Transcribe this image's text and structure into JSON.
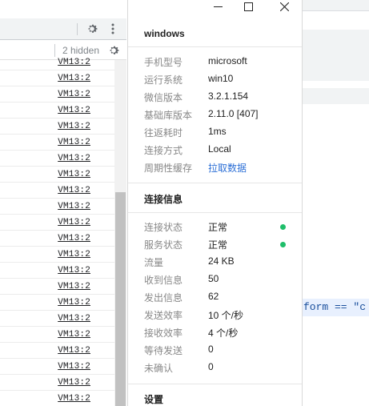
{
  "devtools": {
    "hidden_count": "2 hidden",
    "rows": [
      "VM13:2",
      "VM13:2",
      "VM13:2",
      "VM13:2",
      "VM13:2",
      "VM13:2",
      "VM13:2",
      "VM13:2",
      "VM13:2",
      "VM13:2",
      "VM13:2",
      "VM13:2",
      "VM13:2",
      "VM13:2",
      "VM13:2",
      "VM13:2",
      "VM13:2",
      "VM13:2",
      "VM13:2",
      "VM13:2",
      "VM13:2",
      "VM13:2"
    ]
  },
  "editor": {
    "code_snippet": "form == \"c"
  },
  "panel": {
    "title": "windows",
    "info": [
      {
        "key": "手机型号",
        "value": "microsoft"
      },
      {
        "key": "运行系统",
        "value": "win10"
      },
      {
        "key": "微信版本",
        "value": "3.2.1.154"
      },
      {
        "key": "基础库版本",
        "value": "2.11.0 [407]"
      },
      {
        "key": "往返耗时",
        "value": "1ms"
      },
      {
        "key": "连接方式",
        "value": "Local"
      },
      {
        "key": "周期性缓存",
        "value": "拉取数据"
      }
    ],
    "connection_section": "连接信息",
    "connection": [
      {
        "key": "连接状态",
        "value": "正常",
        "status": "ok"
      },
      {
        "key": "服务状态",
        "value": "正常",
        "status": "ok"
      },
      {
        "key": "流量",
        "value": "24 KB"
      },
      {
        "key": "收到信息",
        "value": "50"
      },
      {
        "key": "发出信息",
        "value": "62"
      },
      {
        "key": "发送效率",
        "value": "10 个/秒"
      },
      {
        "key": "接收效率",
        "value": "4 个/秒"
      },
      {
        "key": "等待发送",
        "value": "0"
      },
      {
        "key": "未确认",
        "value": "0"
      }
    ],
    "settings_section": "设置",
    "colors": {
      "status_ok": "#1fbe6a",
      "link": "#2c6fd6"
    }
  }
}
